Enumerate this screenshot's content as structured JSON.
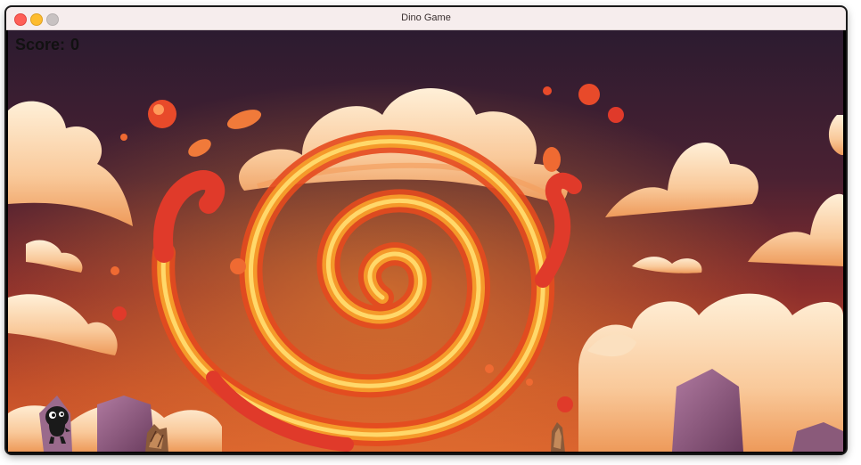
{
  "window": {
    "title": "Dino Game"
  },
  "hud": {
    "score_label": "Score:",
    "score_value": "0"
  },
  "colors": {
    "sky_top": "#2e1c30",
    "sky_mid": "#7a2a2e",
    "sky_bottom": "#c24a2a",
    "swirl_outer": "#f0a02a",
    "swirl_inner": "#ffd060",
    "fire_red": "#e03a2a",
    "cloud_light": "#fde2c0",
    "cloud_shadow": "#f1a868",
    "rock": "#8a5a7a"
  }
}
